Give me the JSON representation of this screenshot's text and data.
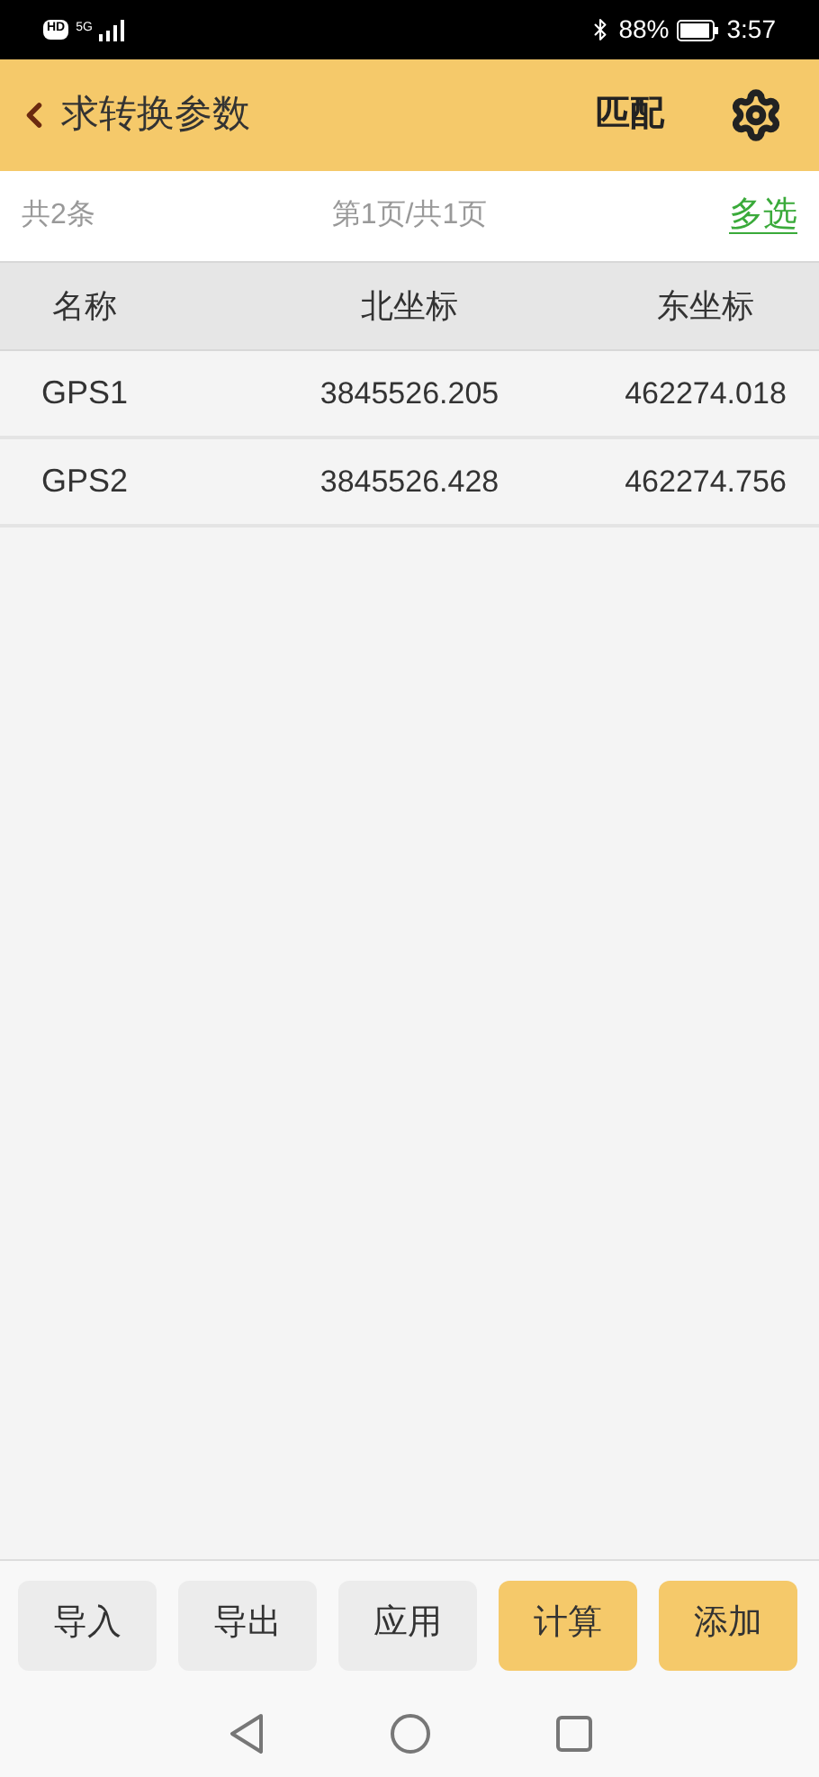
{
  "status_bar": {
    "hd": "HD",
    "network": "5G",
    "battery": "88%",
    "time": "3:57"
  },
  "header": {
    "title": "求转换参数",
    "action": "匹配"
  },
  "info": {
    "count": "共2条",
    "page": "第1页/共1页",
    "multi_select": "多选"
  },
  "table": {
    "columns": [
      "名称",
      "北坐标",
      "东坐标"
    ],
    "rows": [
      [
        "GPS1",
        "3845526.205",
        "462274.018"
      ],
      [
        "GPS2",
        "3845526.428",
        "462274.756"
      ]
    ]
  },
  "buttons": [
    {
      "label": "导入",
      "kind": "default"
    },
    {
      "label": "导出",
      "kind": "default"
    },
    {
      "label": "应用",
      "kind": "default"
    },
    {
      "label": "计算",
      "kind": "primary"
    },
    {
      "label": "添加",
      "kind": "primary"
    }
  ]
}
